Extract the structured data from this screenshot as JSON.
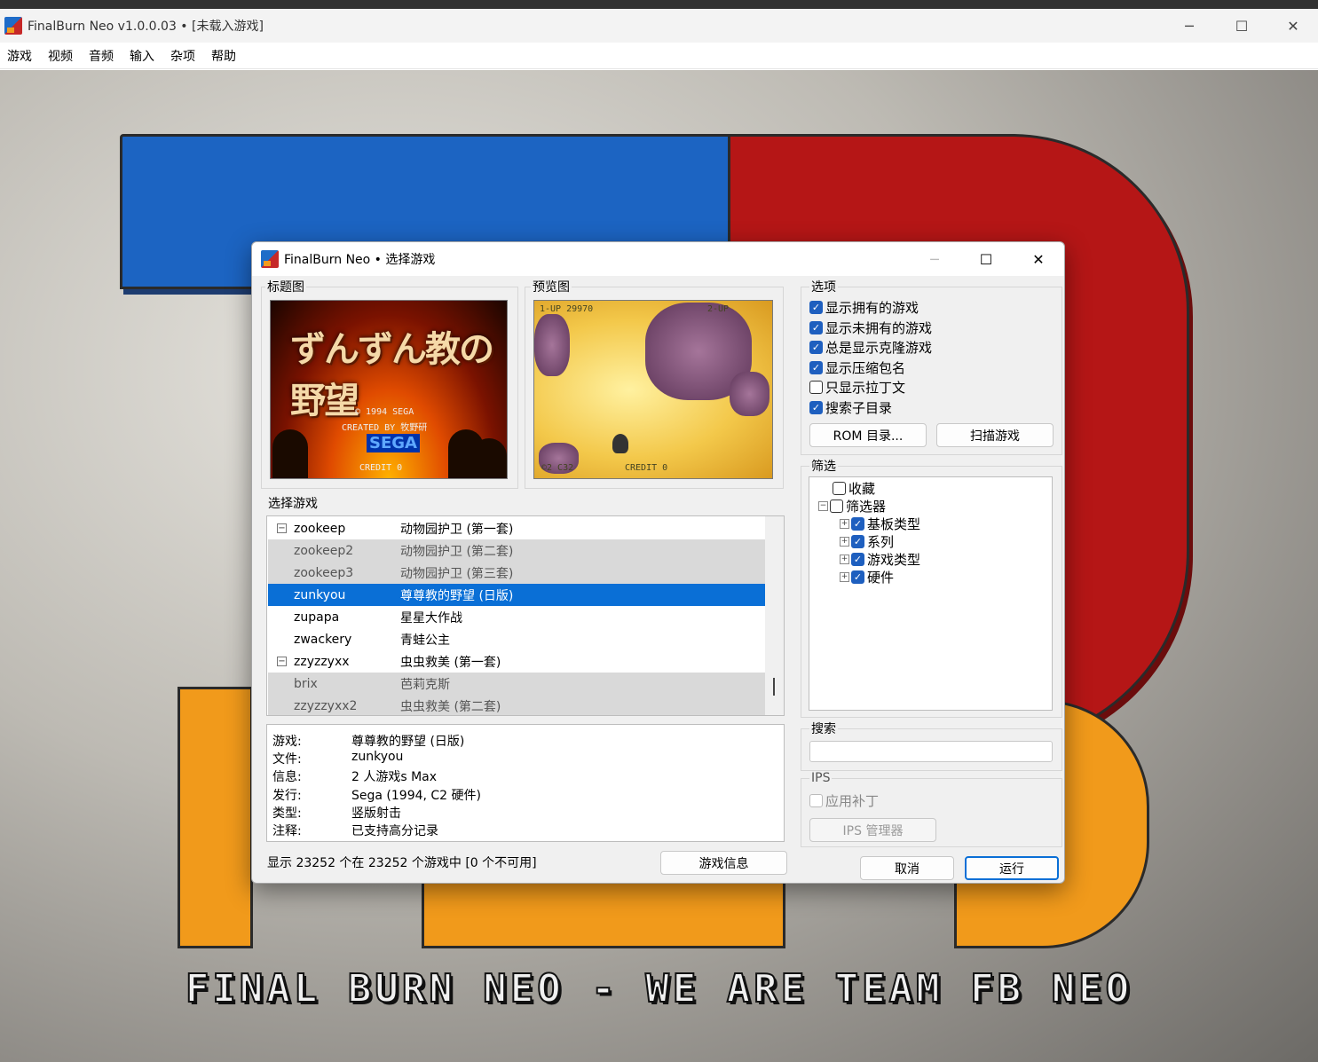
{
  "window": {
    "title": "FinalBurn Neo v1.0.0.03 • [未载入游戏]",
    "min": "─",
    "max": "☐",
    "close": "✕"
  },
  "menu": [
    "游戏",
    "视频",
    "音频",
    "输入",
    "杂项",
    "帮助"
  ],
  "background": {
    "slogan": "FINAL BURN NEO - WE ARE TEAM FB NEO"
  },
  "dialog": {
    "title": "FinalBurn Neo • 选择游戏",
    "title_art_label": "标题图",
    "preview_label": "预览图",
    "title_art": {
      "logo_text": "ずんずん教の野望",
      "copyright": "© 1994 SEGA",
      "created": "CREATED BY 牧野研",
      "sega": "SEGA",
      "credit": "CREDIT  0"
    },
    "preview_art": {
      "p1": "1-UP 29970",
      "p2": "2-UP",
      "lives": "©2 C32",
      "credit": "CREDIT  0"
    },
    "select_label": "选择游戏",
    "games": [
      {
        "rom": "zookeep",
        "name": "动物园护卫 (第一套)",
        "type": "parent"
      },
      {
        "rom": "zookeep2",
        "name": "动物园护卫 (第二套)",
        "type": "clone"
      },
      {
        "rom": "zookeep3",
        "name": "动物园护卫 (第三套)",
        "type": "clone"
      },
      {
        "rom": "zunkyou",
        "name": "尊尊教的野望 (日版)",
        "type": "selected"
      },
      {
        "rom": "zupapa",
        "name": "星星大作战",
        "type": "normal"
      },
      {
        "rom": "zwackery",
        "name": "青蛙公主",
        "type": "normal"
      },
      {
        "rom": "zzyzzyxx",
        "name": "虫虫救美 (第一套)",
        "type": "parent"
      },
      {
        "rom": "brix",
        "name": "芭莉克斯",
        "type": "clone"
      },
      {
        "rom": "zzyzzyxx2",
        "name": "虫虫救美 (第二套)",
        "type": "clone"
      }
    ],
    "info": [
      {
        "key": "游戏:",
        "value": "尊尊教的野望 (日版)"
      },
      {
        "key": "文件:",
        "value": "zunkyou"
      },
      {
        "key": "信息:",
        "value": "2 人游戏s Max"
      },
      {
        "key": "发行:",
        "value": "Sega (1994, C2 硬件)"
      },
      {
        "key": "类型:",
        "value": "竖版射击"
      },
      {
        "key": "注释:",
        "value": "已支持高分记录"
      }
    ],
    "status": "显示 23252 个在 23252 个游戏中 [0 个不可用]",
    "game_info_button": "游戏信息",
    "options_label": "选项",
    "options": [
      {
        "label": "显示拥有的游戏",
        "checked": true
      },
      {
        "label": "显示未拥有的游戏",
        "checked": true
      },
      {
        "label": "总是显示克隆游戏",
        "checked": true
      },
      {
        "label": "显示压缩包名",
        "checked": true
      },
      {
        "label": "只显示拉丁文",
        "checked": false
      },
      {
        "label": "搜索子目录",
        "checked": true
      }
    ],
    "rom_dir_button": "ROM 目录...",
    "scan_button": "扫描游戏",
    "filter_label": "筛选",
    "filter_tree": {
      "favorites": "收藏",
      "filters": "筛选器",
      "children": [
        "基板类型",
        "系列",
        "游戏类型",
        "硬件"
      ]
    },
    "search_label": "搜索",
    "search_value": "",
    "ips_label": "IPS",
    "ips_apply": "应用补丁",
    "ips_manager": "IPS 管理器",
    "cancel_button": "取消",
    "run_button": "运行",
    "accent_color": "#0a6fd6"
  }
}
